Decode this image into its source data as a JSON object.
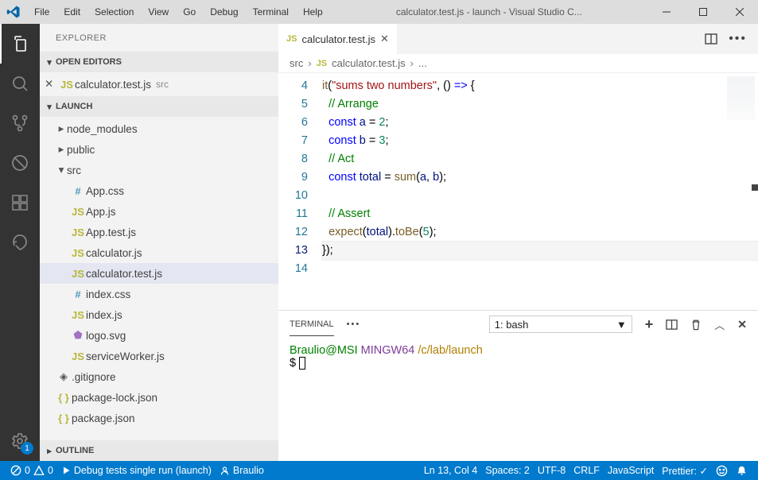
{
  "title_bar": {
    "menu": [
      "File",
      "Edit",
      "Selection",
      "View",
      "Go",
      "Debug",
      "Terminal",
      "Help"
    ],
    "title": "calculator.test.js - launch - Visual Studio C..."
  },
  "sidebar": {
    "title": "EXPLORER",
    "sections": {
      "open_editors": {
        "label": "OPEN EDITORS",
        "items": [
          {
            "icon": "js",
            "name": "calculator.test.js",
            "sub": "src"
          }
        ]
      },
      "project": {
        "label": "LAUNCH",
        "tree": [
          {
            "type": "folder",
            "state": "collapsed",
            "name": "node_modules"
          },
          {
            "type": "folder",
            "state": "collapsed",
            "name": "public"
          },
          {
            "type": "folder",
            "state": "expanded",
            "name": "src"
          },
          {
            "type": "file",
            "icon": "css",
            "name": "App.css",
            "depth": 2
          },
          {
            "type": "file",
            "icon": "js",
            "name": "App.js",
            "depth": 2
          },
          {
            "type": "file",
            "icon": "js",
            "name": "App.test.js",
            "depth": 2
          },
          {
            "type": "file",
            "icon": "js",
            "name": "calculator.js",
            "depth": 2
          },
          {
            "type": "file",
            "icon": "js",
            "name": "calculator.test.js",
            "depth": 2,
            "active": true
          },
          {
            "type": "file",
            "icon": "css",
            "name": "index.css",
            "depth": 2
          },
          {
            "type": "file",
            "icon": "js",
            "name": "index.js",
            "depth": 2
          },
          {
            "type": "file",
            "icon": "svg",
            "name": "logo.svg",
            "depth": 2
          },
          {
            "type": "file",
            "icon": "js",
            "name": "serviceWorker.js",
            "depth": 2
          },
          {
            "type": "file",
            "icon": "git",
            "name": ".gitignore",
            "depth": 1
          },
          {
            "type": "file",
            "icon": "json",
            "name": "package-lock.json",
            "depth": 1
          },
          {
            "type": "file",
            "icon": "json",
            "name": "package.json",
            "depth": 1
          }
        ]
      },
      "outline": {
        "label": "OUTLINE"
      }
    }
  },
  "editor": {
    "tab": {
      "icon": "js",
      "label": "calculator.test.js"
    },
    "breadcrumb": [
      "src",
      "calculator.test.js",
      "..."
    ],
    "lines": [
      {
        "num": 4,
        "tokens": [
          {
            "t": "fn",
            "v": "it"
          },
          {
            "t": "",
            "v": "("
          },
          {
            "t": "str",
            "v": "\"sums two numbers\""
          },
          {
            "t": "",
            "v": ", () "
          },
          {
            "t": "kw",
            "v": "=>"
          },
          {
            "t": "",
            "v": " {"
          }
        ]
      },
      {
        "num": 5,
        "tokens": [
          {
            "t": "",
            "v": "  "
          },
          {
            "t": "cm",
            "v": "// Arrange"
          }
        ]
      },
      {
        "num": 6,
        "tokens": [
          {
            "t": "",
            "v": "  "
          },
          {
            "t": "kw",
            "v": "const"
          },
          {
            "t": "",
            "v": " "
          },
          {
            "t": "var",
            "v": "a"
          },
          {
            "t": "",
            "v": " = "
          },
          {
            "t": "num",
            "v": "2"
          },
          {
            "t": "",
            "v": ";"
          }
        ]
      },
      {
        "num": 7,
        "tokens": [
          {
            "t": "",
            "v": "  "
          },
          {
            "t": "kw",
            "v": "const"
          },
          {
            "t": "",
            "v": " "
          },
          {
            "t": "var",
            "v": "b"
          },
          {
            "t": "",
            "v": " = "
          },
          {
            "t": "num",
            "v": "3"
          },
          {
            "t": "",
            "v": ";"
          }
        ]
      },
      {
        "num": 8,
        "tokens": [
          {
            "t": "",
            "v": "  "
          },
          {
            "t": "cm",
            "v": "// Act"
          }
        ]
      },
      {
        "num": 9,
        "tokens": [
          {
            "t": "",
            "v": "  "
          },
          {
            "t": "kw",
            "v": "const"
          },
          {
            "t": "",
            "v": " "
          },
          {
            "t": "var",
            "v": "total"
          },
          {
            "t": "",
            "v": " = "
          },
          {
            "t": "fn",
            "v": "sum"
          },
          {
            "t": "",
            "v": "("
          },
          {
            "t": "var",
            "v": "a"
          },
          {
            "t": "",
            "v": ", "
          },
          {
            "t": "var",
            "v": "b"
          },
          {
            "t": "",
            "v": ");"
          }
        ]
      },
      {
        "num": 10,
        "tokens": []
      },
      {
        "num": 11,
        "tokens": [
          {
            "t": "",
            "v": "  "
          },
          {
            "t": "cm",
            "v": "// Assert"
          }
        ]
      },
      {
        "num": 12,
        "tokens": [
          {
            "t": "",
            "v": "  "
          },
          {
            "t": "fn",
            "v": "expect"
          },
          {
            "t": "",
            "v": "("
          },
          {
            "t": "var",
            "v": "total"
          },
          {
            "t": "",
            "v": ")."
          },
          {
            "t": "fn",
            "v": "toBe"
          },
          {
            "t": "",
            "v": "("
          },
          {
            "t": "num",
            "v": "5"
          },
          {
            "t": "",
            "v": ");"
          }
        ]
      },
      {
        "num": 13,
        "tokens": [
          {
            "t": "",
            "v": "});"
          }
        ],
        "active": true
      },
      {
        "num": 14,
        "tokens": []
      }
    ]
  },
  "terminal": {
    "label": "TERMINAL",
    "dropdown": "1: bash",
    "line1_user": "Braulio@MSI",
    "line1_ming": " MINGW64",
    "line1_path": " /c/lab/launch",
    "prompt": "$ "
  },
  "status": {
    "errors": "0",
    "warnings": "0",
    "debug": "Debug tests single run (launch)",
    "live_share": "Braulio",
    "ln_col": "Ln 13, Col 4",
    "spaces": "Spaces: 2",
    "encoding": "UTF-8",
    "eol": "CRLF",
    "language": "JavaScript",
    "prettier": "Prettier: ✓"
  },
  "activity_badge": "1"
}
